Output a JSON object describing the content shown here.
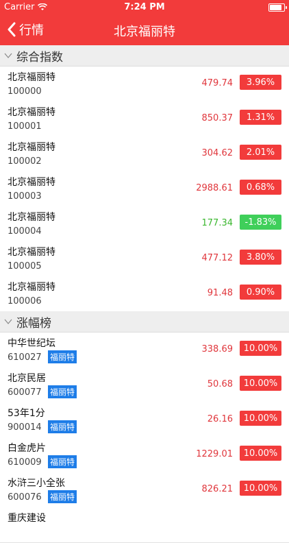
{
  "status_bar": {
    "carrier": "Carrier",
    "time": "7:24 PM",
    "battery_level": 0.9
  },
  "nav": {
    "back_label": "行情",
    "title": "北京福丽特"
  },
  "colors": {
    "brand": "#f23b3b",
    "up": "#f23b3b",
    "down": "#3fcf5a",
    "tag": "#1e7de8"
  },
  "sections": [
    {
      "title": "综合指数",
      "rows": [
        {
          "name": "北京福丽特",
          "code": "100000",
          "price": "479.74",
          "change": "3.96%",
          "trend": "up"
        },
        {
          "name": "北京福丽特",
          "code": "100001",
          "price": "850.37",
          "change": "1.31%",
          "trend": "up"
        },
        {
          "name": "北京福丽特",
          "code": "100002",
          "price": "304.62",
          "change": "2.01%",
          "trend": "up"
        },
        {
          "name": "北京福丽特",
          "code": "100003",
          "price": "2988.61",
          "change": "0.68%",
          "trend": "up"
        },
        {
          "name": "北京福丽特",
          "code": "100004",
          "price": "177.34",
          "change": "-1.83%",
          "trend": "down"
        },
        {
          "name": "北京福丽特",
          "code": "100005",
          "price": "477.12",
          "change": "3.80%",
          "trend": "up"
        },
        {
          "name": "北京福丽特",
          "code": "100006",
          "price": "91.48",
          "change": "0.90%",
          "trend": "up"
        }
      ]
    },
    {
      "title": "涨幅榜",
      "rows": [
        {
          "name": "中华世纪坛",
          "code": "610027",
          "tag": "福丽特",
          "price": "338.69",
          "change": "10.00%",
          "trend": "up"
        },
        {
          "name": "北京民居",
          "code": "600077",
          "tag": "福丽特",
          "price": "50.68",
          "change": "10.00%",
          "trend": "up"
        },
        {
          "name": "53年1分",
          "code": "900014",
          "tag": "福丽特",
          "price": "26.16",
          "change": "10.00%",
          "trend": "up"
        },
        {
          "name": "白金虎片",
          "code": "610009",
          "tag": "福丽特",
          "price": "1229.01",
          "change": "10.00%",
          "trend": "up"
        },
        {
          "name": "水浒三小全张",
          "code": "600076",
          "tag": "福丽特",
          "price": "826.21",
          "change": "10.00%",
          "trend": "up"
        },
        {
          "name": "重庆建设",
          "code": "",
          "tag": "",
          "price": "",
          "change": "",
          "trend": "up"
        }
      ]
    }
  ]
}
